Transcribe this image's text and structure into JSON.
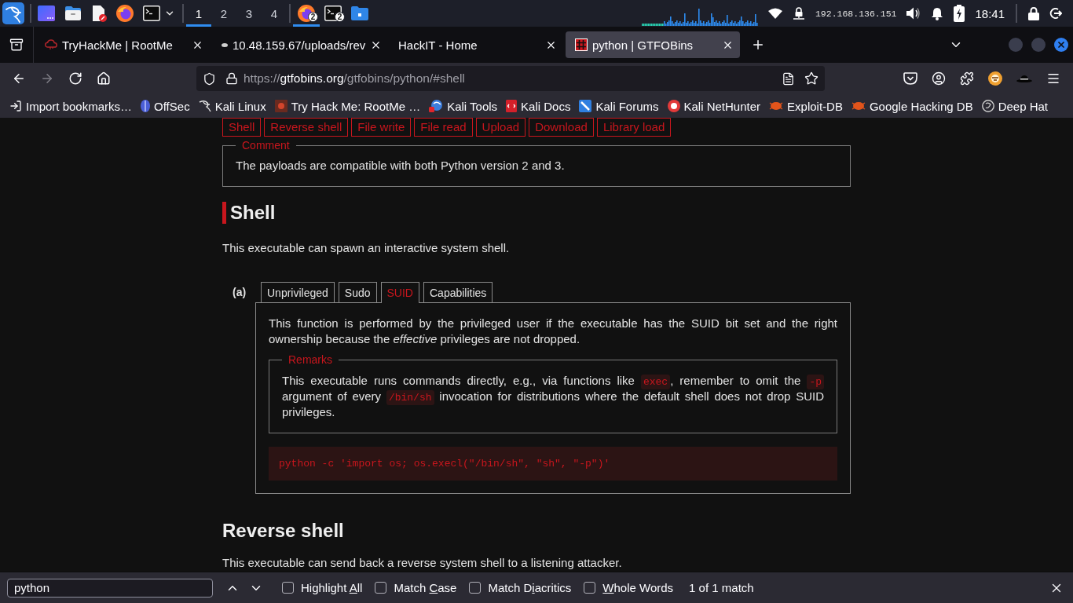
{
  "taskbar": {
    "workspaces": [
      {
        "label": "1",
        "selected": true
      },
      {
        "label": "2",
        "selected": false
      },
      {
        "label": "3",
        "selected": false
      },
      {
        "label": "4",
        "selected": false
      }
    ],
    "windows": [
      {
        "badge": "2",
        "active": true
      },
      {
        "badge": "2",
        "active": false
      },
      {
        "active": false
      }
    ],
    "ip_address": "192.168.136.151",
    "clock": "18:41"
  },
  "browser": {
    "tabs": [
      {
        "title": "TryHackMe | RootMe",
        "selected": false
      },
      {
        "title": "10.48.159.67/uploads/rev",
        "selected": false
      },
      {
        "title": "HackIT - Home",
        "selected": false
      },
      {
        "title": "python | GTFOBins",
        "selected": true
      }
    ],
    "nav_buttons": [
      {
        "disabled": false
      },
      {
        "disabled": true
      },
      {
        "disabled": false
      },
      {
        "disabled": false
      }
    ],
    "url": {
      "scheme": "https://",
      "host": "gtfobins.org",
      "path": "/gtfobins/python/#shell"
    },
    "bookmarks": [
      "Import bookmarks…",
      "OffSec",
      "Kali Linux",
      "Try Hack Me: RootMe …",
      "Kali Tools",
      "Kali Docs",
      "Kali Forums",
      "Kali NetHunter",
      "Exploit-DB",
      "Google Hacking DB",
      "Deep Hat"
    ]
  },
  "page": {
    "section_links": [
      "Shell",
      "Reverse shell",
      "File write",
      "File read",
      "Upload",
      "Download",
      "Library load"
    ],
    "comment": {
      "legend": "Comment",
      "text": "The payloads are compatible with both Python version 2 and 3."
    },
    "sections": [
      {
        "title": "Shell",
        "highlighted": true,
        "description": "This executable can spawn an interactive system shell.",
        "examples": [
          {
            "label": "(a)",
            "tabs": [
              {
                "label": "Unprivileged",
                "selected": false
              },
              {
                "label": "Sudo",
                "selected": false
              },
              {
                "label": "SUID",
                "selected": true
              },
              {
                "label": "Capabilities",
                "selected": false
              }
            ],
            "panel": {
              "text": "This function is performed by the privileged user if the executable has the SUID bit set and the right ownership because the *effective* privileges are not dropped.",
              "remarks": {
                "legend": "Remarks",
                "segments": [
                  {
                    "kind": "text",
                    "text": "This executable runs commands directly, e.g., via functions like "
                  },
                  {
                    "kind": "code",
                    "text": "exec"
                  },
                  {
                    "kind": "text",
                    "text": ", remember to omit the "
                  },
                  {
                    "kind": "code",
                    "text": "-p"
                  },
                  {
                    "kind": "text",
                    "text": " argument of every "
                  },
                  {
                    "kind": "code",
                    "text": "/bin/sh"
                  },
                  {
                    "kind": "text",
                    "text": " invocation for distributions where the default shell does not drop SUID privileges."
                  }
                ]
              },
              "code": "python -c 'import os; os.execl(\"/bin/sh\", \"sh\", \"-p\")'"
            }
          }
        ]
      },
      {
        "title": "Reverse shell",
        "highlighted": false,
        "description": "This executable can send back a reverse system shell to a listening attacker."
      }
    ]
  },
  "find_bar": {
    "query": "python",
    "options": [
      {
        "before": "Highlight ",
        "key": "A",
        "after": "ll",
        "checked": false
      },
      {
        "before": "Match ",
        "key": "C",
        "after": "ase",
        "checked": false
      },
      {
        "before": "Match D",
        "key": "i",
        "after": "acritics",
        "checked": false
      },
      {
        "key": "W",
        "after": "hole Words",
        "checked": false
      }
    ],
    "status": "1 of 1 match"
  }
}
